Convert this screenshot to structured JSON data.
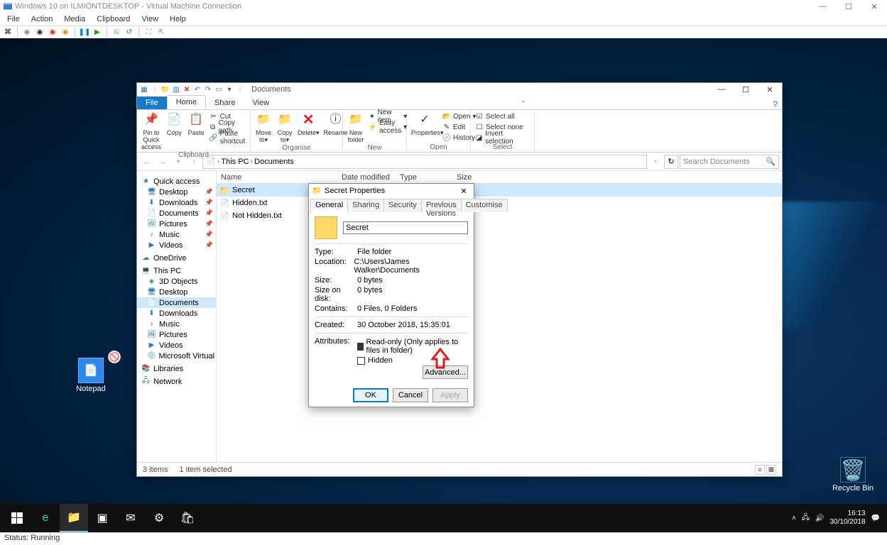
{
  "hyperv": {
    "title": "Windows 10 on ILMIONTDESKTOP - Virtual Machine Connection",
    "menu": [
      "File",
      "Action",
      "Media",
      "Clipboard",
      "View",
      "Help"
    ],
    "status": "Status: Running"
  },
  "desktop": {
    "notepad": "Notepad",
    "recycle": "Recycle Bin",
    "clock_time": "16:13",
    "clock_date": "30/10/2018"
  },
  "explorer": {
    "title": "Documents",
    "tabs": {
      "file": "File",
      "home": "Home",
      "share": "Share",
      "view": "View"
    },
    "ribbon": {
      "clipboard": {
        "label": "Clipboard",
        "pin": "Pin to Quick access",
        "copy": "Copy",
        "paste": "Paste",
        "cut": "Cut",
        "copy_path": "Copy path",
        "paste_shortcut": "Paste shortcut"
      },
      "organise": {
        "label": "Organise",
        "move_to": "Move to",
        "copy_to": "Copy to",
        "delete": "Delete",
        "rename": "Rename"
      },
      "new": {
        "label": "New",
        "new_folder": "New folder",
        "new_item": "New item",
        "easy_access": "Easy access"
      },
      "open": {
        "label": "Open",
        "properties": "Properties",
        "open": "Open",
        "edit": "Edit",
        "history": "History"
      },
      "select": {
        "label": "Select",
        "select_all": "Select all",
        "select_none": "Select none",
        "invert": "Invert selection"
      }
    },
    "breadcrumb": [
      "This PC",
      "Documents"
    ],
    "search_placeholder": "Search Documents",
    "columns": {
      "name": "Name",
      "date": "Date modified",
      "type": "Type",
      "size": "Size"
    },
    "files": [
      {
        "name": "Secret",
        "icon": "folder"
      },
      {
        "name": "Hidden.txt",
        "icon": "file"
      },
      {
        "name": "Not Hidden.txt",
        "icon": "file"
      }
    ],
    "nav": {
      "quick_access": "Quick access",
      "qa_items": [
        "Desktop",
        "Downloads",
        "Documents",
        "Pictures",
        "Music",
        "Videos"
      ],
      "onedrive": "OneDrive",
      "this_pc": "This PC",
      "pc_items": [
        "3D Objects",
        "Desktop",
        "Documents",
        "Downloads",
        "Music",
        "Pictures",
        "Videos",
        "Microsoft Virtual Di"
      ],
      "libraries": "Libraries",
      "network": "Network"
    },
    "status": {
      "items": "3 items",
      "selected": "1 item selected"
    }
  },
  "props": {
    "title": "Secret Properties",
    "tabs": [
      "General",
      "Sharing",
      "Security",
      "Previous Versions",
      "Customise"
    ],
    "name_value": "Secret",
    "rows": {
      "type_k": "Type:",
      "type_v": "File folder",
      "loc_k": "Location:",
      "loc_v": "C:\\Users\\James Walker\\Documents",
      "size_k": "Size:",
      "size_v": "0 bytes",
      "disk_k": "Size on disk:",
      "disk_v": "0 bytes",
      "contains_k": "Contains:",
      "contains_v": "0 Files, 0 Folders",
      "created_k": "Created:",
      "created_v": "30 October 2018, 15:35:01",
      "attr_k": "Attributes:"
    },
    "readonly": "Read-only (Only applies to files in folder)",
    "hidden": "Hidden",
    "advanced": "Advanced...",
    "ok": "OK",
    "cancel": "Cancel",
    "apply": "Apply"
  }
}
